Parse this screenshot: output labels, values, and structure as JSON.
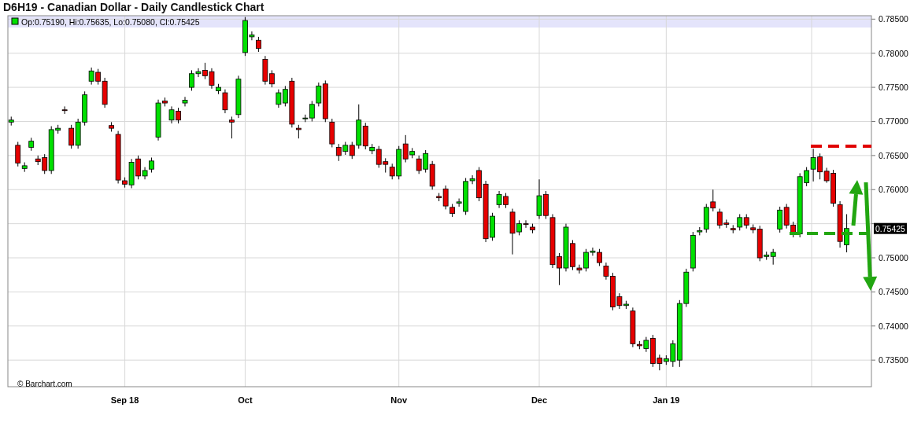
{
  "chart": {
    "legend": "Op:0.75190, Hi:0.75635, Lo:0.75080, Cl:0.75425",
    "credit": "© Barchart.com",
    "price_tag": "0.75425",
    "chart_data": {
      "type": "candlestick",
      "title": "D6H19 - Canadian Dollar - Daily Candlestick Chart",
      "grid": true,
      "ylim": [
        0.7311,
        0.7855
      ],
      "categories": [
        null,
        null,
        null,
        null,
        null,
        null,
        null,
        null,
        null,
        null,
        null,
        null,
        null,
        null,
        null,
        null,
        null,
        "Sep 18",
        null,
        null,
        null,
        null,
        null,
        null,
        null,
        null,
        null,
        null,
        null,
        null,
        null,
        null,
        null,
        null,
        null,
        "Oct",
        null,
        null,
        null,
        null,
        null,
        null,
        null,
        null,
        null,
        null,
        null,
        null,
        null,
        null,
        null,
        null,
        null,
        null,
        null,
        null,
        null,
        null,
        "Nov",
        null,
        null,
        null,
        null,
        null,
        null,
        null,
        null,
        null,
        null,
        null,
        null,
        null,
        null,
        null,
        null,
        null,
        null,
        null,
        null,
        "Dec",
        null,
        null,
        null,
        null,
        null,
        null,
        null,
        null,
        null,
        null,
        null,
        null,
        null,
        null,
        null,
        null,
        null,
        null,
        "Jan 19",
        null,
        null,
        null,
        null,
        null,
        null,
        null,
        null,
        null,
        null,
        null,
        null,
        null,
        null,
        null,
        null,
        null,
        null,
        null,
        null,
        null,
        null,
        null,
        null,
        null,
        null,
        null
      ],
      "yticks": [
        {
          "value": 0.735,
          "label": "0.73500"
        },
        {
          "value": 0.74,
          "label": "0.74000"
        },
        {
          "value": 0.745,
          "label": "0.74500"
        },
        {
          "value": 0.75,
          "label": "0.75000"
        },
        {
          "value": 0.76,
          "label": "0.76000"
        },
        {
          "value": 0.765,
          "label": "0.76500"
        },
        {
          "value": 0.77,
          "label": "0.77000"
        },
        {
          "value": 0.775,
          "label": "0.77500"
        },
        {
          "value": 0.78,
          "label": "0.78000"
        },
        {
          "value": 0.785,
          "label": "0.78500"
        }
      ],
      "ohlc": [
        [
          0.7699,
          0.7707,
          0.7694,
          0.7702
        ],
        [
          0.7665,
          0.767,
          0.7634,
          0.7639
        ],
        [
          0.7631,
          0.764,
          0.7626,
          0.7635
        ],
        [
          0.7662,
          0.7676,
          0.7657,
          0.7671
        ],
        [
          0.7645,
          0.765,
          0.7636,
          0.7641
        ],
        [
          0.7647,
          0.7652,
          0.7623,
          0.7628
        ],
        [
          0.7628,
          0.7693,
          0.7623,
          0.7688
        ],
        [
          0.7687,
          0.7695,
          0.7682,
          0.769
        ],
        [
          0.7717,
          0.7722,
          0.7711,
          0.7716
        ],
        [
          0.769,
          0.7695,
          0.766,
          0.7665
        ],
        [
          0.7665,
          0.7704,
          0.766,
          0.7699
        ],
        [
          0.7699,
          0.7744,
          0.7694,
          0.7739
        ],
        [
          0.7759,
          0.7779,
          0.7754,
          0.7774
        ],
        [
          0.7772,
          0.7777,
          0.7754,
          0.7759
        ],
        [
          0.7759,
          0.7764,
          0.772,
          0.7725
        ],
        [
          0.7694,
          0.7699,
          0.7685,
          0.769
        ],
        [
          0.7681,
          0.7686,
          0.7609,
          0.7614
        ],
        [
          0.7613,
          0.7618,
          0.7603,
          0.7608
        ],
        [
          0.7607,
          0.7645,
          0.7602,
          0.764
        ],
        [
          0.7645,
          0.765,
          0.7615,
          0.762
        ],
        [
          0.762,
          0.7633,
          0.7615,
          0.7628
        ],
        [
          0.763,
          0.7647,
          0.7625,
          0.7642
        ],
        [
          0.7677,
          0.7732,
          0.7672,
          0.7727
        ],
        [
          0.773,
          0.7735,
          0.7722,
          0.7727
        ],
        [
          0.7702,
          0.7722,
          0.7697,
          0.7717
        ],
        [
          0.7715,
          0.772,
          0.7697,
          0.7702
        ],
        [
          0.7727,
          0.7736,
          0.7722,
          0.7731
        ],
        [
          0.775,
          0.7775,
          0.7745,
          0.777
        ],
        [
          0.777,
          0.7778,
          0.7765,
          0.7773
        ],
        [
          0.7775,
          0.7786,
          0.7762,
          0.7767
        ],
        [
          0.7773,
          0.7778,
          0.7748,
          0.7753
        ],
        [
          0.7745,
          0.7755,
          0.774,
          0.775
        ],
        [
          0.7742,
          0.7747,
          0.7712,
          0.7717
        ],
        [
          0.7702,
          0.7707,
          0.7675,
          0.7699
        ],
        [
          0.771,
          0.7767,
          0.7705,
          0.7762
        ],
        [
          0.7801,
          0.7853,
          0.7796,
          0.7848
        ],
        [
          0.7824,
          0.7832,
          0.7819,
          0.7827
        ],
        [
          0.7819,
          0.7824,
          0.7802,
          0.7807
        ],
        [
          0.7791,
          0.7796,
          0.7754,
          0.7759
        ],
        [
          0.777,
          0.7775,
          0.775,
          0.7755
        ],
        [
          0.7725,
          0.7747,
          0.772,
          0.7742
        ],
        [
          0.7727,
          0.7752,
          0.7722,
          0.7747
        ],
        [
          0.7759,
          0.7764,
          0.7691,
          0.7696
        ],
        [
          0.769,
          0.7695,
          0.7675,
          0.7688
        ],
        [
          0.7704,
          0.771,
          0.7699,
          0.7705
        ],
        [
          0.7705,
          0.773,
          0.77,
          0.7725
        ],
        [
          0.7727,
          0.7757,
          0.7722,
          0.7752
        ],
        [
          0.7755,
          0.776,
          0.7699,
          0.7704
        ],
        [
          0.7699,
          0.7704,
          0.7662,
          0.7667
        ],
        [
          0.7662,
          0.7667,
          0.7642,
          0.765
        ],
        [
          0.7656,
          0.767,
          0.7651,
          0.7665
        ],
        [
          0.7665,
          0.767,
          0.7645,
          0.765
        ],
        [
          0.7665,
          0.7725,
          0.766,
          0.7702
        ],
        [
          0.7693,
          0.7698,
          0.7659,
          0.7664
        ],
        [
          0.7657,
          0.7667,
          0.7652,
          0.7662
        ],
        [
          0.7659,
          0.7664,
          0.7632,
          0.7637
        ],
        [
          0.7641,
          0.7646,
          0.7625,
          0.7637
        ],
        [
          0.7633,
          0.7638,
          0.7615,
          0.762
        ],
        [
          0.762,
          0.7664,
          0.7615,
          0.7659
        ],
        [
          0.7667,
          0.768,
          0.764,
          0.7645
        ],
        [
          0.7651,
          0.7661,
          0.7646,
          0.7656
        ],
        [
          0.7645,
          0.765,
          0.7623,
          0.7628
        ],
        [
          0.763,
          0.7658,
          0.7625,
          0.7653
        ],
        [
          0.7637,
          0.7642,
          0.76,
          0.7605
        ],
        [
          0.759,
          0.7595,
          0.7583,
          0.7588
        ],
        [
          0.7601,
          0.7606,
          0.7571,
          0.7576
        ],
        [
          0.7574,
          0.7579,
          0.756,
          0.7565
        ],
        [
          0.758,
          0.7587,
          0.7575,
          0.7582
        ],
        [
          0.7568,
          0.7617,
          0.7563,
          0.7612
        ],
        [
          0.7613,
          0.7621,
          0.7608,
          0.7616
        ],
        [
          0.7628,
          0.7633,
          0.7583,
          0.7588
        ],
        [
          0.7608,
          0.7613,
          0.7523,
          0.7528
        ],
        [
          0.753,
          0.7566,
          0.7525,
          0.7561
        ],
        [
          0.7578,
          0.7598,
          0.7573,
          0.7593
        ],
        [
          0.759,
          0.7595,
          0.7573,
          0.7578
        ],
        [
          0.7567,
          0.7572,
          0.7505,
          0.7536
        ],
        [
          0.7538,
          0.7555,
          0.7533,
          0.755
        ],
        [
          0.755,
          0.7555,
          0.7544,
          0.7549
        ],
        [
          0.7545,
          0.755,
          0.7536,
          0.7541
        ],
        [
          0.7562,
          0.7615,
          0.7557,
          0.7591
        ],
        [
          0.7593,
          0.7598,
          0.7557,
          0.7562
        ],
        [
          0.7559,
          0.7564,
          0.7485,
          0.749
        ],
        [
          0.7502,
          0.7507,
          0.746,
          0.7485
        ],
        [
          0.7485,
          0.755,
          0.748,
          0.7545
        ],
        [
          0.7521,
          0.7526,
          0.7482,
          0.7487
        ],
        [
          0.7485,
          0.749,
          0.7477,
          0.7482
        ],
        [
          0.7485,
          0.7513,
          0.748,
          0.7508
        ],
        [
          0.7508,
          0.7515,
          0.7503,
          0.751
        ],
        [
          0.7508,
          0.7513,
          0.7488,
          0.7493
        ],
        [
          0.7488,
          0.7493,
          0.7468,
          0.7473
        ],
        [
          0.7473,
          0.7478,
          0.7423,
          0.7428
        ],
        [
          0.7443,
          0.7448,
          0.7425,
          0.743
        ],
        [
          0.743,
          0.7437,
          0.7425,
          0.7432
        ],
        [
          0.7422,
          0.7427,
          0.7369,
          0.7374
        ],
        [
          0.7373,
          0.7378,
          0.7366,
          0.7371
        ],
        [
          0.7367,
          0.7384,
          0.7362,
          0.7379
        ],
        [
          0.7382,
          0.7387,
          0.734,
          0.7345
        ],
        [
          0.7353,
          0.7358,
          0.7335,
          0.7345
        ],
        [
          0.7348,
          0.7357,
          0.7343,
          0.7352
        ],
        [
          0.7348,
          0.7379,
          0.734,
          0.7374
        ],
        [
          0.735,
          0.7438,
          0.734,
          0.7433
        ],
        [
          0.7433,
          0.7484,
          0.7428,
          0.7479
        ],
        [
          0.7485,
          0.7538,
          0.748,
          0.7533
        ],
        [
          0.7538,
          0.7545,
          0.7533,
          0.754
        ],
        [
          0.7542,
          0.7579,
          0.7537,
          0.7574
        ],
        [
          0.7582,
          0.76,
          0.7568,
          0.7573
        ],
        [
          0.7567,
          0.7572,
          0.7543,
          0.7548
        ],
        [
          0.7551,
          0.7556,
          0.7544,
          0.7549
        ],
        [
          0.7543,
          0.7548,
          0.7536,
          0.7541
        ],
        [
          0.7545,
          0.7564,
          0.754,
          0.7559
        ],
        [
          0.7559,
          0.7564,
          0.7543,
          0.7548
        ],
        [
          0.7544,
          0.7549,
          0.7536,
          0.7541
        ],
        [
          0.7542,
          0.7547,
          0.7495,
          0.75
        ],
        [
          0.7502,
          0.7509,
          0.7497,
          0.7504
        ],
        [
          0.7502,
          0.7513,
          0.749,
          0.7508
        ],
        [
          0.7542,
          0.7575,
          0.7537,
          0.757
        ],
        [
          0.7574,
          0.7579,
          0.7543,
          0.7548
        ],
        [
          0.7548,
          0.7553,
          0.753,
          0.7535
        ],
        [
          0.7535,
          0.7624,
          0.753,
          0.7619
        ],
        [
          0.761,
          0.7633,
          0.7605,
          0.7628
        ],
        [
          0.763,
          0.766,
          0.7612,
          0.7647
        ],
        [
          0.7648,
          0.7653,
          0.7615,
          0.7626
        ],
        [
          0.7627,
          0.7632,
          0.761,
          0.7613
        ],
        [
          0.7624,
          0.7629,
          0.7575,
          0.758
        ],
        [
          0.7578,
          0.7583,
          0.7515,
          0.7524
        ],
        [
          0.7519,
          0.7564,
          0.7508,
          0.7543
        ]
      ]
    }
  }
}
